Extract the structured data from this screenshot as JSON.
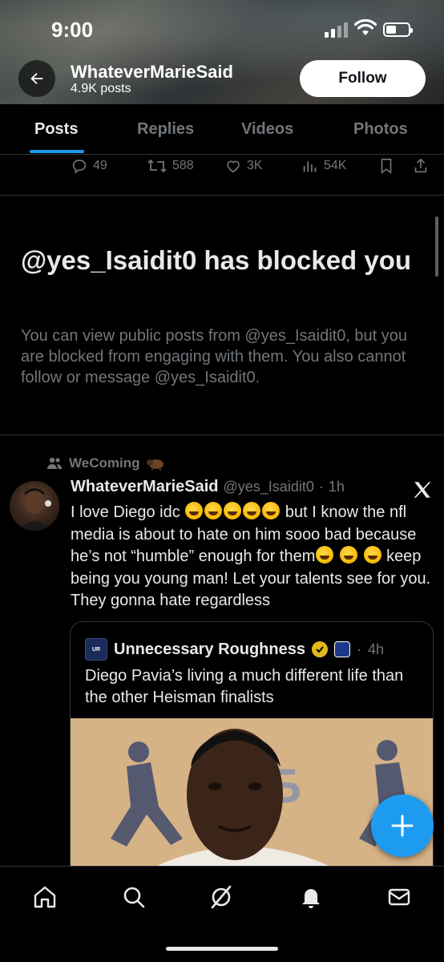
{
  "status_bar": {
    "time": "9:00"
  },
  "header": {
    "profile_name": "WhateverMarieSaid",
    "post_count": "4.9K posts",
    "follow_label": "Follow"
  },
  "tabs": [
    {
      "label": "Posts",
      "active": true
    },
    {
      "label": "Replies",
      "active": false
    },
    {
      "label": "Videos",
      "active": false
    },
    {
      "label": "Photos",
      "active": false
    }
  ],
  "prev_tweet_actions": {
    "replies": "49",
    "reposts": "588",
    "likes": "3K",
    "views": "54K"
  },
  "blocked": {
    "title": "@yes_Isaidit0 has blocked you",
    "description": "You can view public posts from @yes_Isaidit0, but you are blocked from engaging with them. You also cannot follow or message @yes_Isaidit0."
  },
  "tweet": {
    "reposted_by": "WeComing",
    "author_name": "WhateverMarieSaid",
    "author_handle": "@yes_Isaidit0",
    "timestamp": "1h",
    "text_part1": "I love Diego idc",
    "text_part2": "but I know  the nfl  media is about to hate on him sooo bad because he’s not “humble” enough for them",
    "text_part3": "keep being you young man! Let your talents see for you. They gonna hate regardless",
    "emoji_name": "rolling-on-floor-laughing-emoji"
  },
  "quote": {
    "author_name": "Unnecessary Roughness",
    "timestamp": "4h",
    "text": "Diego Pavia’s living a much different life than the other Heisman finalists"
  },
  "colors": {
    "accent": "#1d9bf0",
    "muted_text": "#71767b",
    "primary_text": "#e7e9ea",
    "background": "#000000",
    "divider": "#2f3336"
  }
}
